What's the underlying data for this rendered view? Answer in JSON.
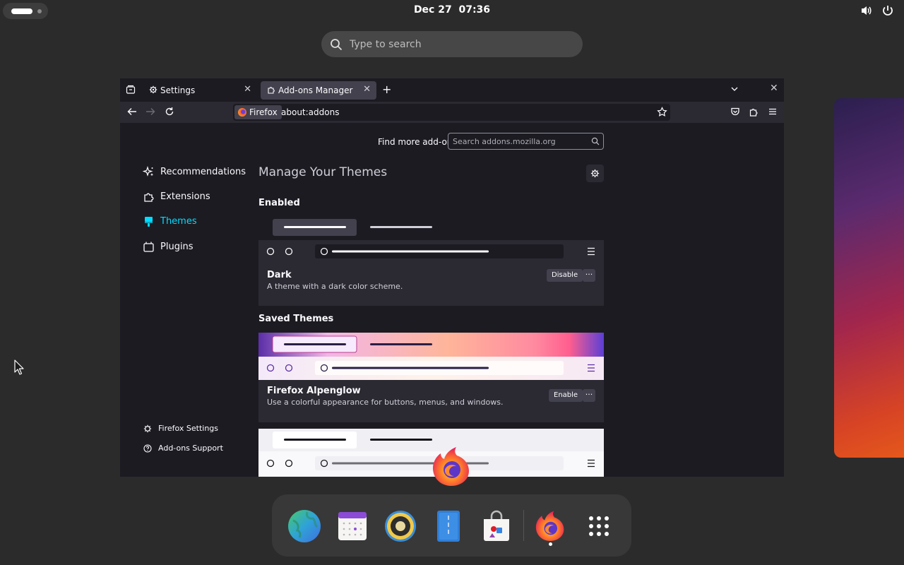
{
  "topbar": {
    "date": "Dec 27",
    "time": "07:36"
  },
  "search": {
    "placeholder": "Type to search"
  },
  "browser": {
    "tabs": [
      {
        "label": "Settings"
      },
      {
        "label": "Add-ons Manager"
      }
    ],
    "identity_label": "Firefox",
    "url": "about:addons"
  },
  "addons": {
    "find_more_label": "Find more add-ons",
    "search_placeholder": "Search addons.mozilla.org",
    "categories": [
      {
        "label": "Recommendations",
        "icon": "sparkle-icon"
      },
      {
        "label": "Extensions",
        "icon": "puzzle-icon"
      },
      {
        "label": "Themes",
        "icon": "brush-icon",
        "selected": true
      },
      {
        "label": "Plugins",
        "icon": "plugin-icon"
      }
    ],
    "footer_links": [
      {
        "label": "Firefox Settings",
        "icon": "gear-icon"
      },
      {
        "label": "Add-ons Support",
        "icon": "help-icon"
      }
    ],
    "heading": "Manage Your Themes",
    "enabled_heading": "Enabled",
    "saved_heading": "Saved Themes",
    "enabled_theme": {
      "name": "Dark",
      "description": "A theme with a dark color scheme.",
      "button": "Disable",
      "more": "···"
    },
    "saved_themes": [
      {
        "name": "Firefox Alpenglow",
        "description": "Use a colorful appearance for buttons, menus, and windows.",
        "button": "Enable",
        "more": "···"
      }
    ]
  },
  "dock": {
    "apps": [
      "browser-globe-icon",
      "calendar-icon",
      "speaker-icon",
      "notes-icon",
      "software-store-icon",
      "firefox-icon",
      "app-grid-icon"
    ]
  }
}
